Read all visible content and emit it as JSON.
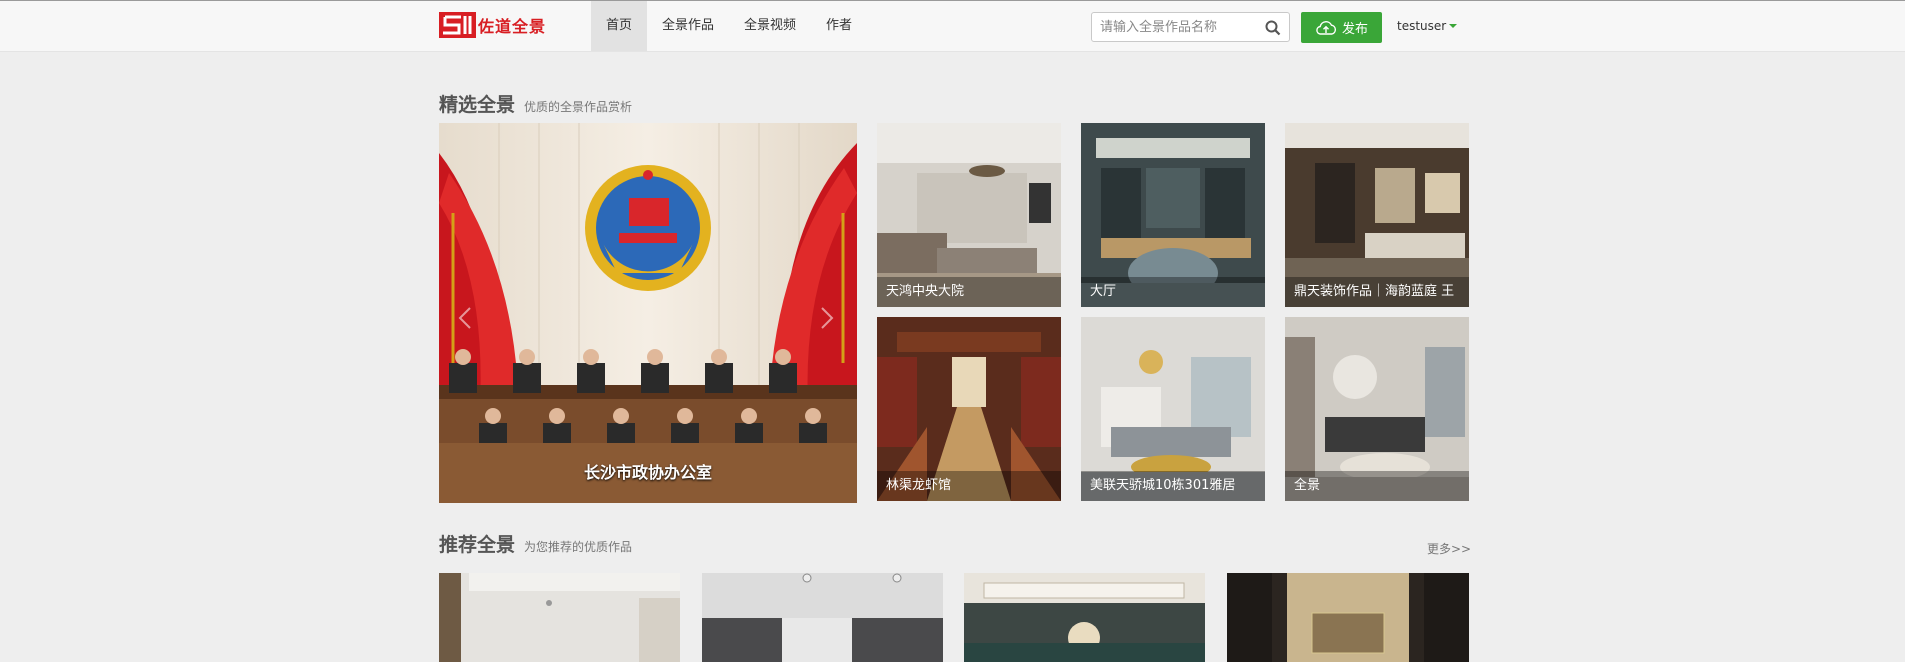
{
  "brand": {
    "name": "佐道全景",
    "logo_icon": "logo-mark-icon",
    "color": "#d81e23"
  },
  "nav": {
    "items": [
      {
        "label": "首页",
        "active": true
      },
      {
        "label": "全景作品",
        "active": false
      },
      {
        "label": "全景视频",
        "active": false
      },
      {
        "label": "作者",
        "active": false
      }
    ]
  },
  "search": {
    "placeholder": "请输入全景作品名称",
    "value": "",
    "icon": "search-icon"
  },
  "publish": {
    "label": "发布",
    "icon": "cloud-upload-icon",
    "color": "#3aa638"
  },
  "user": {
    "name": "testuser"
  },
  "featured": {
    "title": "精选全景",
    "subtitle": "优质的全景作品赏析",
    "hero": {
      "caption": "长沙市政协办公室"
    },
    "tiles": [
      {
        "caption": "天鸿中央大院"
      },
      {
        "caption": "大厅"
      },
      {
        "caption": "鼎天装饰作品｜海韵蓝庭 王"
      },
      {
        "caption": "林渠龙虾馆"
      },
      {
        "caption": "美联天骄城10栋301雅居"
      },
      {
        "caption": "全景"
      }
    ]
  },
  "recommended": {
    "title": "推荐全景",
    "subtitle": "为您推荐的优质作品",
    "more_label": "更多>>"
  }
}
